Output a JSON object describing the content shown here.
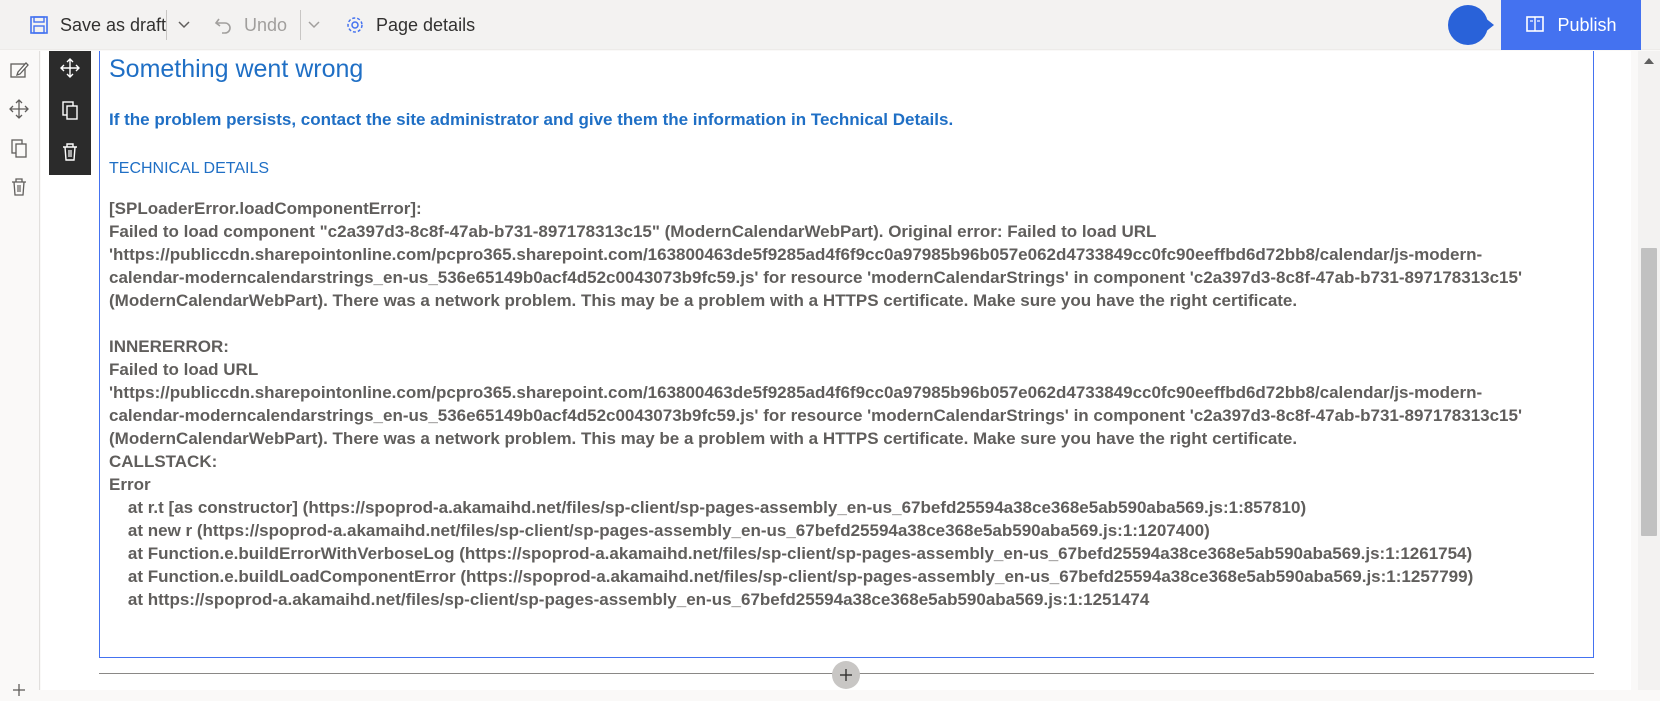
{
  "commandbar": {
    "save_draft": "Save as draft",
    "undo": "Undo",
    "page_details": "Page details",
    "publish": "Publish"
  },
  "error": {
    "title": "Something went wrong",
    "subtitle": "If the problem persists, contact the site administrator and give them the information in Technical Details.",
    "tech_label": "TECHNICAL DETAILS",
    "tech_text": "[SPLoaderError.loadComponentError]:\nFailed to load component \"c2a397d3-8c8f-47ab-b731-897178313c15\" (ModernCalendarWebPart). Original error: Failed to load URL\n'https://publiccdn.sharepointonline.com/pcpro365.sharepoint.com/163800463de5f9285ad4f6f9cc0a97985b96b057e062d4733849cc0fc90eeffbd6d72bb8/calendar/js-modern-\ncalendar-moderncalendarstrings_en-us_536e65149b0acf4d52c0043073b9fc59.js' for resource 'modernCalendarStrings' in component 'c2a397d3-8c8f-47ab-b731-897178313c15'\n(ModernCalendarWebPart). There was a network problem. This may be a problem with a HTTPS certificate. Make sure you have the right certificate.\n\nINNERERROR:\nFailed to load URL\n'https://publiccdn.sharepointonline.com/pcpro365.sharepoint.com/163800463de5f9285ad4f6f9cc0a97985b96b057e062d4733849cc0fc90eeffbd6d72bb8/calendar/js-modern-\ncalendar-moderncalendarstrings_en-us_536e65149b0acf4d52c0043073b9fc59.js' for resource 'modernCalendarStrings' in component 'c2a397d3-8c8f-47ab-b731-897178313c15'\n(ModernCalendarWebPart). There was a network problem. This may be a problem with a HTTPS certificate. Make sure you have the right certificate.\nCALLSTACK:\nError\n    at r.t [as constructor] (https://spoprod-a.akamaihd.net/files/sp-client/sp-pages-assembly_en-us_67befd25594a38ce368e5ab590aba569.js:1:857810)\n    at new r (https://spoprod-a.akamaihd.net/files/sp-client/sp-pages-assembly_en-us_67befd25594a38ce368e5ab590aba569.js:1:1207400)\n    at Function.e.buildErrorWithVerboseLog (https://spoprod-a.akamaihd.net/files/sp-client/sp-pages-assembly_en-us_67befd25594a38ce368e5ab590aba569.js:1:1261754)\n    at Function.e.buildLoadComponentError (https://spoprod-a.akamaihd.net/files/sp-client/sp-pages-assembly_en-us_67befd25594a38ce368e5ab590aba569.js:1:1257799)\n    at https://spoprod-a.akamaihd.net/files/sp-client/sp-pages-assembly_en-us_67befd25594a38ce368e5ab590aba569.js:1:1251474"
  },
  "icons": {
    "save": "save-icon",
    "undo": "undo-icon",
    "settings": "gear-icon",
    "publish": "book-icon",
    "edit": "edit-icon",
    "move": "move-icon",
    "duplicate": "duplicate-icon",
    "delete": "trash-icon",
    "add": "plus-icon"
  },
  "colors": {
    "accent": "#4472f0",
    "error_blue": "#1f6fc5",
    "text_gray": "#605e5c",
    "toolbar_dark": "#2b2b2b"
  }
}
